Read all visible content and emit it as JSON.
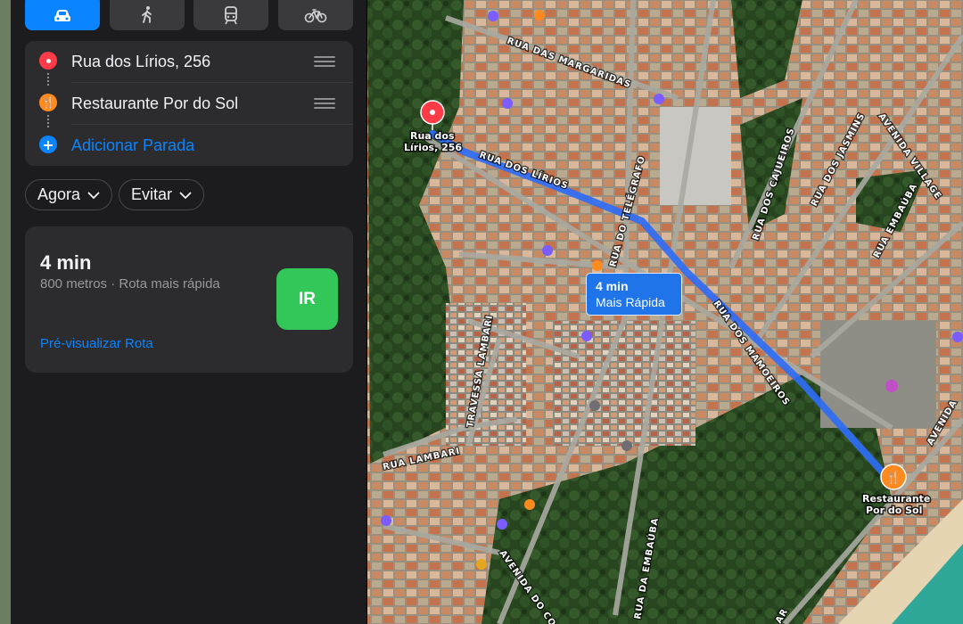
{
  "transport_modes": [
    {
      "name": "car",
      "icon": "car-icon",
      "active": true
    },
    {
      "name": "walk",
      "icon": "walking-icon",
      "active": false
    },
    {
      "name": "transit",
      "icon": "train-icon",
      "active": false
    },
    {
      "name": "bike",
      "icon": "bicycle-icon",
      "active": false
    }
  ],
  "route": {
    "origin": "Rua dos Lírios, 256",
    "destination": "Restaurante Por do Sol",
    "add_stop": "Adicionar Parada"
  },
  "options": {
    "time_label": "Agora",
    "avoid_label": "Evitar"
  },
  "result": {
    "duration": "4 min",
    "details": "800 metros · Rota mais rápida",
    "go_label": "IR",
    "preview_label": "Pré-visualizar Rota"
  },
  "map": {
    "route_bubble": {
      "duration": "4 min",
      "label": "Mais Rápida"
    },
    "origin_label": [
      "Rua dos",
      "Lírios, 256"
    ],
    "destination_label": [
      "Restaurante",
      "Por do Sol"
    ],
    "streets": [
      "RUA DAS MARGARIDAS",
      "RUA DOS LÍRIOS",
      "RUA DO TELÉGRAFO",
      "RUA DOS MAMOEIROS",
      "RUA DOS CAJUEIROS",
      "RUA DOS JASMINS",
      "AVENIDA VILLAGE",
      "RUA EMBAÚBA",
      "TRAVESSA LAMBARI",
      "RUA LAMBARI",
      "AVENIDA DO CO",
      "RUA DA EMBAÚBA",
      "AVENIDA",
      "AR"
    ]
  },
  "colors": {
    "accent": "#0a84ff",
    "go_button": "#33c759",
    "origin_pin": "#ff3b47",
    "destination_pin": "#ff8a1f",
    "route_line": "#2f6cf5"
  }
}
